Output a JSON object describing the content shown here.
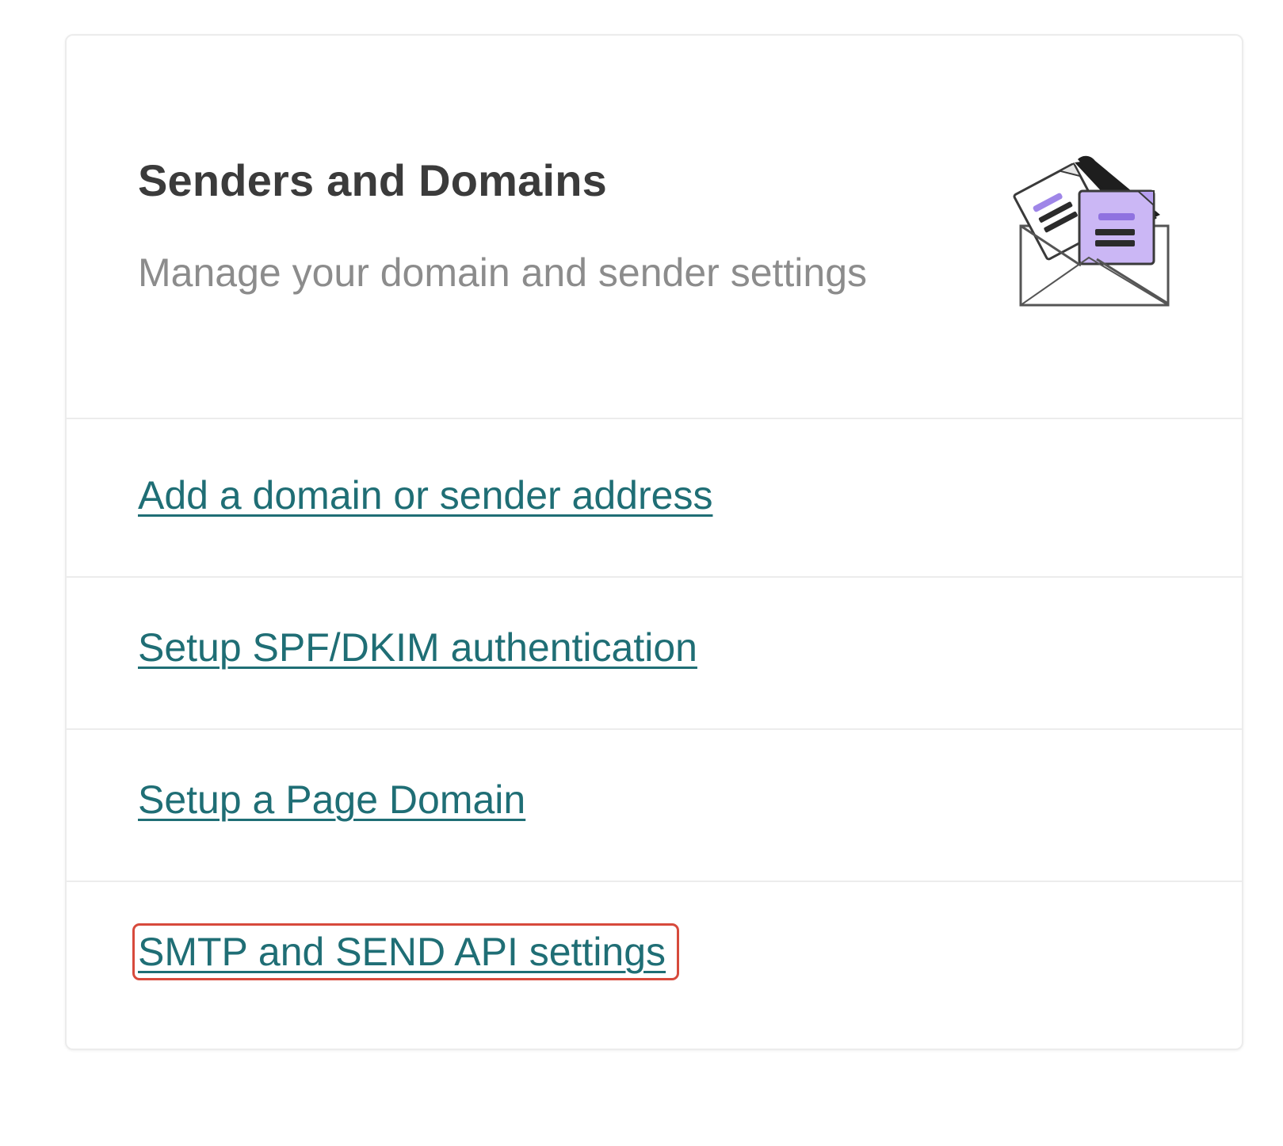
{
  "card": {
    "title": "Senders and Domains",
    "subtitle": "Manage your domain and sender settings",
    "illustration_icon": "envelope-with-letters-icon"
  },
  "links": [
    {
      "label": "Add a domain or sender address"
    },
    {
      "label": "Setup SPF/DKIM authentication"
    },
    {
      "label": "Setup a Page Domain"
    },
    {
      "label": "SMTP and SEND API settings"
    }
  ],
  "colors": {
    "link": "#1f6e75",
    "title": "#3b3b3b",
    "subtitle": "#8c8c8c",
    "focus_outline": "#d74a3c",
    "divider": "#ececec",
    "accent_purple": "#cbb7f5"
  }
}
